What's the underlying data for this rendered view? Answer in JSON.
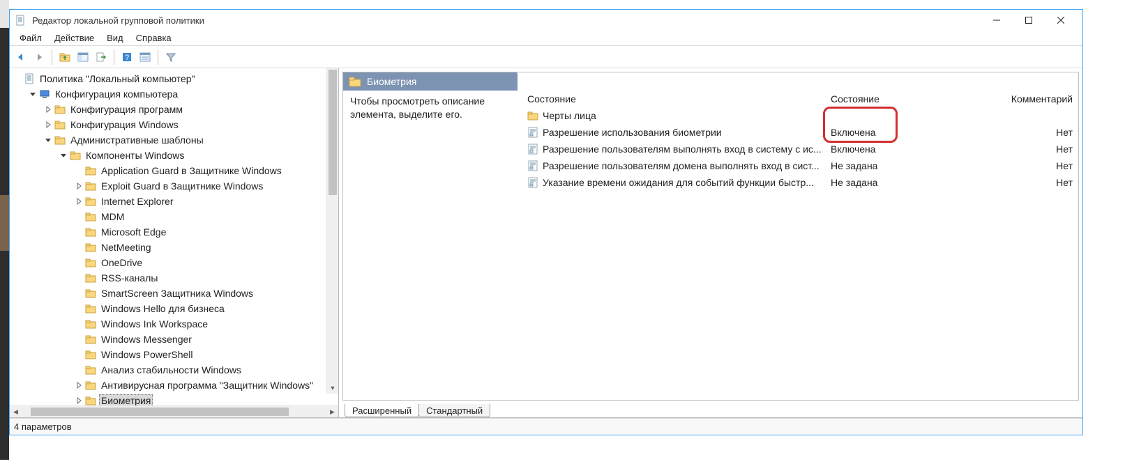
{
  "window": {
    "title": "Редактор локальной групповой политики"
  },
  "menu": {
    "file": "Файл",
    "action": "Действие",
    "view": "Вид",
    "help": "Справка"
  },
  "tree": [
    {
      "indent": 0,
      "caret": "none",
      "icon": "doc",
      "label": "Политика \"Локальный компьютер\""
    },
    {
      "indent": 1,
      "caret": "open",
      "icon": "computer",
      "label": "Конфигурация компьютера"
    },
    {
      "indent": 2,
      "caret": "closed",
      "icon": "folder",
      "label": "Конфигурация программ"
    },
    {
      "indent": 2,
      "caret": "closed",
      "icon": "folder",
      "label": "Конфигурация Windows"
    },
    {
      "indent": 2,
      "caret": "open",
      "icon": "folder",
      "label": "Административные шаблоны"
    },
    {
      "indent": 3,
      "caret": "open",
      "icon": "folder",
      "label": "Компоненты Windows"
    },
    {
      "indent": 4,
      "caret": "none",
      "icon": "folder",
      "label": "Application Guard в Защитнике Windows"
    },
    {
      "indent": 4,
      "caret": "closed",
      "icon": "folder",
      "label": "Exploit Guard в Защитнике Windows"
    },
    {
      "indent": 4,
      "caret": "closed",
      "icon": "folder",
      "label": "Internet Explorer"
    },
    {
      "indent": 4,
      "caret": "none",
      "icon": "folder",
      "label": "MDM"
    },
    {
      "indent": 4,
      "caret": "none",
      "icon": "folder",
      "label": "Microsoft Edge"
    },
    {
      "indent": 4,
      "caret": "none",
      "icon": "folder",
      "label": "NetMeeting"
    },
    {
      "indent": 4,
      "caret": "none",
      "icon": "folder",
      "label": "OneDrive"
    },
    {
      "indent": 4,
      "caret": "none",
      "icon": "folder",
      "label": "RSS-каналы"
    },
    {
      "indent": 4,
      "caret": "none",
      "icon": "folder",
      "label": "SmartScreen Защитника Windows"
    },
    {
      "indent": 4,
      "caret": "none",
      "icon": "folder",
      "label": "Windows Hello для бизнеса"
    },
    {
      "indent": 4,
      "caret": "none",
      "icon": "folder",
      "label": "Windows Ink Workspace"
    },
    {
      "indent": 4,
      "caret": "none",
      "icon": "folder",
      "label": "Windows Messenger"
    },
    {
      "indent": 4,
      "caret": "none",
      "icon": "folder",
      "label": "Windows PowerShell"
    },
    {
      "indent": 4,
      "caret": "none",
      "icon": "folder",
      "label": "Анализ стабильности Windows"
    },
    {
      "indent": 4,
      "caret": "closed",
      "icon": "folder",
      "label": "Антивирусная программа \"Защитник Windows\""
    },
    {
      "indent": 4,
      "caret": "closed",
      "icon": "folder",
      "label": "Биометрия",
      "selected": true
    }
  ],
  "category": {
    "title": "Биометрия"
  },
  "description_hint": "Чтобы просмотреть описание элемента, выделите его.",
  "columns": {
    "name": "Состояние",
    "state": "Состояние",
    "comment": "Комментарий"
  },
  "items": [
    {
      "icon": "folder",
      "name": "Черты лица",
      "state": "",
      "comment": ""
    },
    {
      "icon": "setting",
      "name": "Разрешение использования биометрии",
      "state": "Включена",
      "comment": "Нет"
    },
    {
      "icon": "setting",
      "name": "Разрешение пользователям выполнять вход в систему с ис...",
      "state": "Включена",
      "comment": "Нет"
    },
    {
      "icon": "setting",
      "name": "Разрешение пользователям домена выполнять вход в сист...",
      "state": "Не задана",
      "comment": "Нет"
    },
    {
      "icon": "setting",
      "name": "Указание времени ожидания для событий функции быстр...",
      "state": "Не задана",
      "comment": "Нет"
    }
  ],
  "tabs": {
    "extended": "Расширенный",
    "standard": "Стандартный"
  },
  "status": "4 параметров"
}
